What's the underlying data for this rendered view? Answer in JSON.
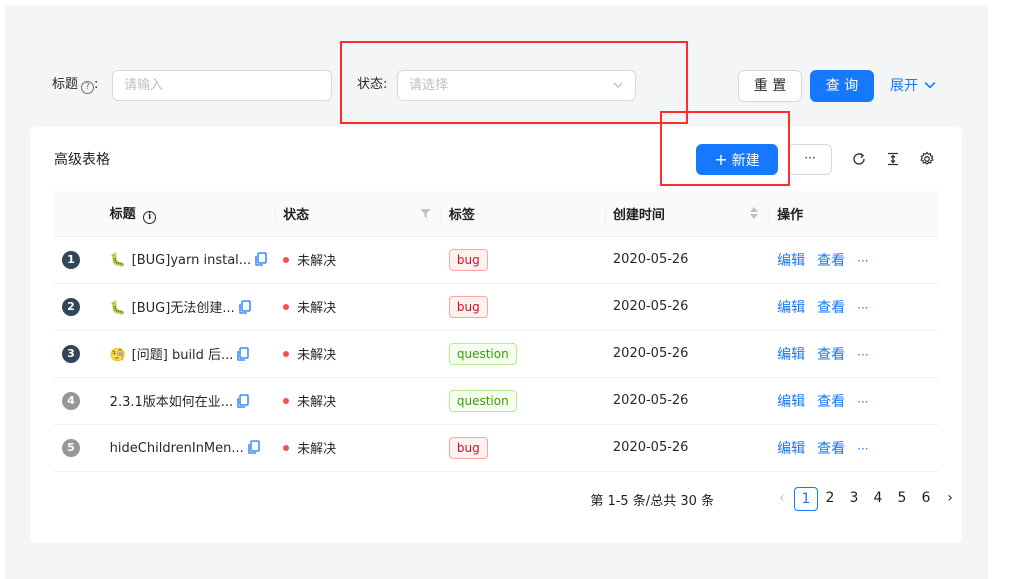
{
  "search": {
    "title_label": "标题",
    "title_placeholder": "请输入",
    "status_label": "状态:",
    "status_placeholder": "请选择",
    "reset_label": "重 置",
    "query_label": "查 询",
    "expand_label": "展开"
  },
  "table": {
    "title": "高级表格",
    "new_button_label": "新建",
    "more_button_label": "···",
    "columns": [
      "标题",
      "状态",
      "标签",
      "创建时间",
      "操作"
    ],
    "rows": [
      {
        "index": "1",
        "emoji": "🐛",
        "title": "[BUG]yarn instal...",
        "status": "未解决",
        "tag": "bug",
        "created": "2020-05-26"
      },
      {
        "index": "2",
        "emoji": "🐛",
        "title": "[BUG]无法创建...",
        "status": "未解决",
        "tag": "bug",
        "created": "2020-05-26"
      },
      {
        "index": "3",
        "emoji": "🧐",
        "title": "[问题] build 后...",
        "status": "未解决",
        "tag": "question",
        "created": "2020-05-26"
      },
      {
        "index": "4",
        "emoji": "",
        "title": "2.3.1版本如何在业...",
        "status": "未解决",
        "tag": "question",
        "created": "2020-05-26"
      },
      {
        "index": "5",
        "emoji": "",
        "title": "hideChildrenInMen...",
        "status": "未解决",
        "tag": "bug",
        "created": "2020-05-26"
      }
    ],
    "actions": {
      "edit": "编辑",
      "view": "查看",
      "more": "···"
    }
  },
  "pagination": {
    "total_text": "第 1-5 条/总共 30 条",
    "pages": [
      "1",
      "2",
      "3",
      "4",
      "5",
      "6"
    ],
    "current": "1"
  },
  "colors": {
    "primary": "#1677ff",
    "highlight": "#ff2d2d",
    "status_dot": "#ff4d4f"
  }
}
